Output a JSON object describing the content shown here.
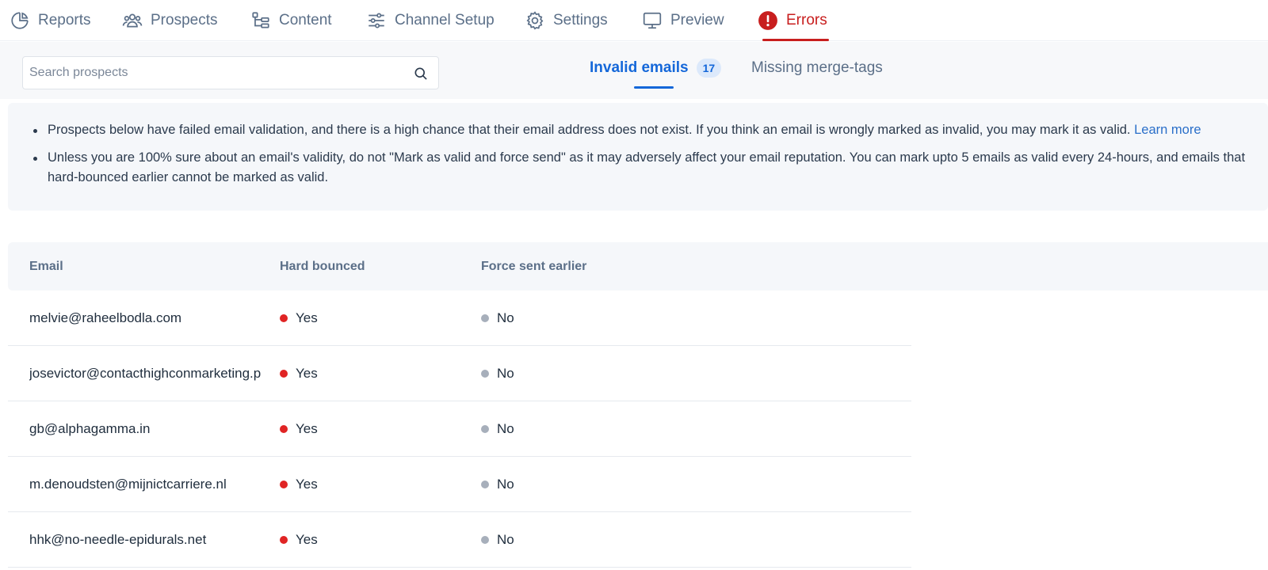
{
  "nav": {
    "items": [
      {
        "label": "Reports",
        "icon": "pie-chart-icon"
      },
      {
        "label": "Prospects",
        "icon": "users-icon"
      },
      {
        "label": "Content",
        "icon": "tree-icon"
      },
      {
        "label": "Channel Setup",
        "icon": "sliders-icon"
      },
      {
        "label": "Settings",
        "icon": "gear-icon"
      },
      {
        "label": "Preview",
        "icon": "monitor-icon"
      },
      {
        "label": "Errors",
        "icon": "alert-icon"
      }
    ],
    "active": "Errors"
  },
  "search": {
    "placeholder": "Search prospects",
    "value": ""
  },
  "subtabs": [
    {
      "label": "Invalid emails",
      "count": "17",
      "active": true
    },
    {
      "label": "Missing merge-tags",
      "active": false
    }
  ],
  "notice": {
    "bullet1_text": "Prospects below have failed email validation, and there is a high chance that their email address does not exist. If you think an email is wrongly marked as invalid, you may mark it as valid.",
    "bullet1_link": "Learn more",
    "bullet2_text": "Unless you are 100% sure about an email's validity, do not \"Mark as valid and force send\" as it may adversely affect your email reputation. You can mark upto 5 emails as valid every 24-hours, and emails that hard-bounced earlier cannot be marked as valid."
  },
  "table": {
    "headers": {
      "email": "Email",
      "hard_bounced": "Hard bounced",
      "force_sent": "Force sent earlier"
    },
    "rows": [
      {
        "email": "melvie@raheelbodla.com",
        "hard_bounced": "Yes",
        "force_sent": "No"
      },
      {
        "email": "josevictor@contacthighconmarketing.p",
        "hard_bounced": "Yes",
        "force_sent": "No"
      },
      {
        "email": "gb@alphagamma.in",
        "hard_bounced": "Yes",
        "force_sent": "No"
      },
      {
        "email": "m.denoudsten@mijnictcarriere.nl",
        "hard_bounced": "Yes",
        "force_sent": "No"
      },
      {
        "email": "hhk@no-needle-epidurals.net",
        "hard_bounced": "Yes",
        "force_sent": "No"
      }
    ]
  },
  "colors": {
    "yes_dot": "#e02424",
    "no_dot": "#a7afbb",
    "active_nav": "#c81e1e",
    "active_subtab": "#1467d9"
  }
}
